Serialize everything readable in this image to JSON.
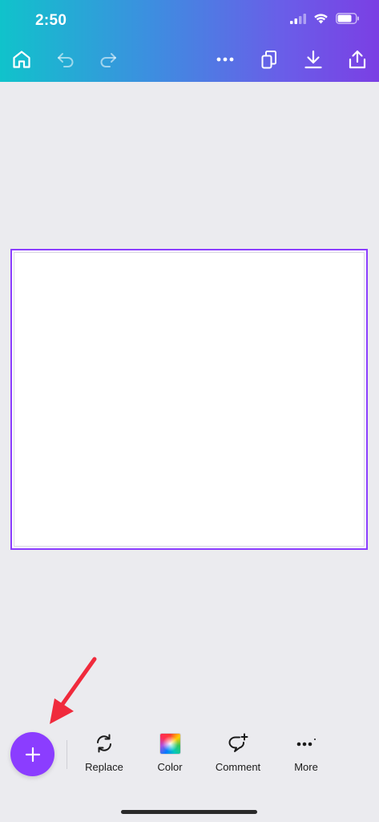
{
  "status_bar": {
    "time": "2:50",
    "icons": [
      "cellular-signal-icon",
      "wifi-icon",
      "battery-icon"
    ]
  },
  "toolbar": {
    "icons": [
      "home-icon",
      "undo-icon",
      "redo-icon",
      "more-options-icon",
      "pages-icon",
      "download-icon",
      "share-icon"
    ],
    "gradient_colors": [
      "#10c3cb",
      "#3d8ee0",
      "#6a5de8",
      "#7b3fe4"
    ]
  },
  "canvas": {
    "selection_color": "#8b3dff"
  },
  "annotation": {
    "icon": "red-arrow-icon",
    "color": "#f02a3c"
  },
  "bottom_toolbar": {
    "add_button_icon": "plus-icon",
    "add_button_color": "#8b3dff",
    "tools": [
      {
        "label": "Replace",
        "icon": "replace-icon"
      },
      {
        "label": "Color",
        "icon": "color-swatch-icon"
      },
      {
        "label": "Comment",
        "icon": "comment-add-icon"
      },
      {
        "label": "More",
        "icon": "more-icon"
      }
    ]
  }
}
